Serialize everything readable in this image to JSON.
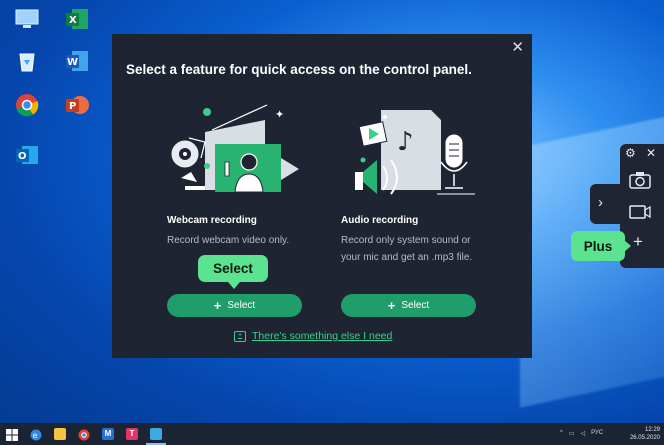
{
  "dialog": {
    "title": "Select a feature for quick access on the control panel.",
    "close_label": "✕",
    "features": [
      {
        "name": "Webcam recording",
        "description": "Record webcam video only.",
        "button_label": "Select"
      },
      {
        "name": "Audio recording",
        "description": "Record only system sound or your mic and get an .mp3 file.",
        "button_label": "Select"
      }
    ],
    "tooltip": "Select",
    "else_link": "There's something else I need"
  },
  "control_panel": {
    "plus_badge": "Plus",
    "icons": [
      "gear-icon",
      "close-icon",
      "camera-icon",
      "chevron-right-icon",
      "video-icon",
      "plus-icon"
    ]
  },
  "taskbar": {
    "tray_lang": "РУС",
    "time": "12:29",
    "date": "26.05.2020"
  },
  "colors": {
    "dialog_bg": "#1e2431",
    "accent_green": "#1f9d6b",
    "highlight_green": "#5ce38f",
    "link_green": "#38d28e"
  }
}
